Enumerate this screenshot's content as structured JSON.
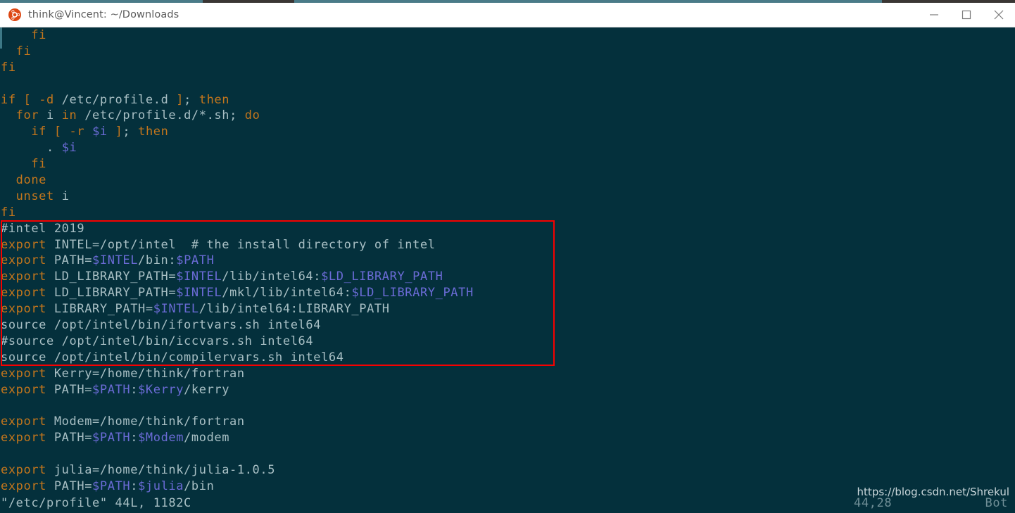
{
  "window": {
    "title": "think@Vincent: ~/Downloads",
    "app_icon": "ubuntu-logo-icon",
    "controls": {
      "minimize": "minimize-icon",
      "maximize": "maximize-icon",
      "close": "close-icon"
    }
  },
  "colors": {
    "terminal_background": "#04303c",
    "titlebar_background": "#ffffff",
    "default_text": "#a8bfc4",
    "keyword": "#c4761c",
    "variable": "#6b6bd6",
    "annotation_box": "#f70000",
    "desktop": "#4a7b88"
  },
  "editor": {
    "file": "/etc/profile",
    "lines": [
      {
        "indent": "    ",
        "spans": [
          {
            "t": "fi",
            "c": "kw"
          }
        ]
      },
      {
        "indent": "  ",
        "spans": [
          {
            "t": "fi",
            "c": "kw"
          }
        ]
      },
      {
        "indent": "",
        "spans": [
          {
            "t": "fi",
            "c": "kw"
          }
        ]
      },
      {
        "indent": "",
        "spans": []
      },
      {
        "indent": "",
        "spans": [
          {
            "t": "if",
            "c": "kw"
          },
          {
            "t": " ",
            "c": "pl"
          },
          {
            "t": "[",
            "c": "kw"
          },
          {
            "t": " ",
            "c": "pl"
          },
          {
            "t": "-d",
            "c": "kw"
          },
          {
            "t": " /etc/profile.d ",
            "c": "pl"
          },
          {
            "t": "]",
            "c": "kw"
          },
          {
            "t": ";",
            "c": "pl"
          },
          {
            "t": " ",
            "c": "pl"
          },
          {
            "t": "then",
            "c": "kw"
          }
        ]
      },
      {
        "indent": "  ",
        "spans": [
          {
            "t": "for",
            "c": "kw"
          },
          {
            "t": " i ",
            "c": "pl"
          },
          {
            "t": "in",
            "c": "kw"
          },
          {
            "t": " /etc/profile.d/*.sh; ",
            "c": "pl"
          },
          {
            "t": "do",
            "c": "kw"
          }
        ]
      },
      {
        "indent": "    ",
        "spans": [
          {
            "t": "if",
            "c": "kw"
          },
          {
            "t": " ",
            "c": "pl"
          },
          {
            "t": "[",
            "c": "kw"
          },
          {
            "t": " ",
            "c": "pl"
          },
          {
            "t": "-r",
            "c": "kw"
          },
          {
            "t": " ",
            "c": "pl"
          },
          {
            "t": "$i",
            "c": "var"
          },
          {
            "t": " ",
            "c": "pl"
          },
          {
            "t": "]",
            "c": "kw"
          },
          {
            "t": ";",
            "c": "pl"
          },
          {
            "t": " ",
            "c": "pl"
          },
          {
            "t": "then",
            "c": "kw"
          }
        ]
      },
      {
        "indent": "      ",
        "spans": [
          {
            "t": ".",
            "c": "pl"
          },
          {
            "t": " ",
            "c": "pl"
          },
          {
            "t": "$i",
            "c": "var"
          }
        ]
      },
      {
        "indent": "    ",
        "spans": [
          {
            "t": "fi",
            "c": "kw"
          }
        ]
      },
      {
        "indent": "  ",
        "spans": [
          {
            "t": "done",
            "c": "kw"
          }
        ]
      },
      {
        "indent": "  ",
        "spans": [
          {
            "t": "unset",
            "c": "kw"
          },
          {
            "t": " i",
            "c": "pl"
          }
        ]
      },
      {
        "indent": "",
        "spans": [
          {
            "t": "fi",
            "c": "kw"
          }
        ]
      },
      {
        "indent": "",
        "spans": [
          {
            "t": "#intel 2019",
            "c": "pl"
          }
        ]
      },
      {
        "indent": "",
        "spans": [
          {
            "t": "export",
            "c": "kw"
          },
          {
            "t": " INTEL=/opt/intel  # the install directory of intel",
            "c": "pl"
          }
        ]
      },
      {
        "indent": "",
        "spans": [
          {
            "t": "export",
            "c": "kw"
          },
          {
            "t": " PATH=",
            "c": "pl"
          },
          {
            "t": "$INTEL",
            "c": "var"
          },
          {
            "t": "/bin:",
            "c": "pl"
          },
          {
            "t": "$PATH",
            "c": "var"
          }
        ]
      },
      {
        "indent": "",
        "spans": [
          {
            "t": "export",
            "c": "kw"
          },
          {
            "t": " LD_LIBRARY_PATH=",
            "c": "pl"
          },
          {
            "t": "$INTEL",
            "c": "var"
          },
          {
            "t": "/lib/intel64:",
            "c": "pl"
          },
          {
            "t": "$LD_LIBRARY_PATH",
            "c": "var"
          }
        ]
      },
      {
        "indent": "",
        "spans": [
          {
            "t": "export",
            "c": "kw"
          },
          {
            "t": " LD_LIBRARY_PATH=",
            "c": "pl"
          },
          {
            "t": "$INTEL",
            "c": "var"
          },
          {
            "t": "/mkl/lib/intel64:",
            "c": "pl"
          },
          {
            "t": "$LD_LIBRARY_PATH",
            "c": "var"
          }
        ]
      },
      {
        "indent": "",
        "spans": [
          {
            "t": "export",
            "c": "kw"
          },
          {
            "t": " LIBRARY_PATH=",
            "c": "pl"
          },
          {
            "t": "$INTEL",
            "c": "var"
          },
          {
            "t": "/lib/intel64:LIBRARY_PATH",
            "c": "pl"
          }
        ]
      },
      {
        "indent": "",
        "spans": [
          {
            "t": "source /opt/intel/bin/ifortvars.sh intel64",
            "c": "pl"
          }
        ]
      },
      {
        "indent": "",
        "spans": [
          {
            "t": "#source /opt/intel/bin/iccvars.sh intel64",
            "c": "pl"
          }
        ]
      },
      {
        "indent": "",
        "spans": [
          {
            "t": "source /opt/intel/bin/compilervars.sh intel64",
            "c": "pl"
          }
        ]
      },
      {
        "indent": "",
        "spans": [
          {
            "t": "export",
            "c": "kw"
          },
          {
            "t": " Kerry=/home/think/fortran",
            "c": "pl"
          }
        ]
      },
      {
        "indent": "",
        "spans": [
          {
            "t": "export",
            "c": "kw"
          },
          {
            "t": " PATH=",
            "c": "pl"
          },
          {
            "t": "$PATH",
            "c": "var"
          },
          {
            "t": ":",
            "c": "pl"
          },
          {
            "t": "$Kerry",
            "c": "var"
          },
          {
            "t": "/kerry",
            "c": "pl"
          }
        ]
      },
      {
        "indent": "",
        "spans": []
      },
      {
        "indent": "",
        "spans": [
          {
            "t": "export",
            "c": "kw"
          },
          {
            "t": " Modem=/home/think/fortran",
            "c": "pl"
          }
        ]
      },
      {
        "indent": "",
        "spans": [
          {
            "t": "export",
            "c": "kw"
          },
          {
            "t": " PATH=",
            "c": "pl"
          },
          {
            "t": "$PATH",
            "c": "var"
          },
          {
            "t": ":",
            "c": "pl"
          },
          {
            "t": "$Modem",
            "c": "var"
          },
          {
            "t": "/modem",
            "c": "pl"
          }
        ]
      },
      {
        "indent": "",
        "spans": []
      },
      {
        "indent": "",
        "spans": [
          {
            "t": "export",
            "c": "kw"
          },
          {
            "t": " julia=/home/think/julia-1.0.5",
            "c": "pl"
          }
        ]
      },
      {
        "indent": "",
        "spans": [
          {
            "t": "export",
            "c": "kw"
          },
          {
            "t": " PATH=",
            "c": "pl"
          },
          {
            "t": "$PATH",
            "c": "var"
          },
          {
            "t": ":",
            "c": "pl"
          },
          {
            "t": "$julia",
            "c": "var"
          },
          {
            "t": "/bin",
            "c": "pl"
          }
        ]
      }
    ]
  },
  "status": {
    "file_info": "\"/etc/profile\" 44L, 1182C",
    "cursor_position": "44,28",
    "scroll_indicator": "Bot"
  },
  "watermark": {
    "text": "https://blog.csdn.net/Shrekul"
  }
}
